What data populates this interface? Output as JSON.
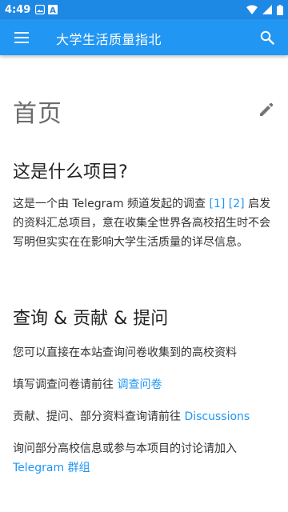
{
  "status_bar": {
    "time": "4:49",
    "icons_left": [
      "image-icon",
      "a-box-icon"
    ],
    "icons_right": [
      "wifi-icon",
      "signal-icon",
      "battery-icon"
    ]
  },
  "app_bar": {
    "title": "大学生活质量指北",
    "menu_icon": "menu-icon",
    "search_icon": "search-icon",
    "color": "#2196f3"
  },
  "page": {
    "title": "首页",
    "sections": [
      {
        "heading": "这是什么项目?",
        "paragraph": {
          "text_before": "这是一个由 Telegram 频道发起的调查 ",
          "refs": [
            "[1]",
            "[2]"
          ],
          "text_after": " 启发的资料汇总项目，意在收集全世界各高校招生时不会写明但实实在在影响大学生活质量的详尽信息。"
        }
      },
      {
        "heading": "查询 & 贡献 & 提问",
        "lines": [
          {
            "text": "您可以直接在本站查询问卷收集到的高校资料"
          },
          {
            "text": "填写调查问卷请前往 ",
            "link": "调查问卷"
          },
          {
            "text": "贡献、提问、部分资料查询请前往 ",
            "link": "Discussions"
          },
          {
            "text": "询问部分高校信息或参与本项目的讨论请加入 ",
            "link": "Telegram 群组"
          }
        ]
      }
    ]
  },
  "colors": {
    "status_bar": "#1e88e5",
    "link": "#2196f3"
  }
}
